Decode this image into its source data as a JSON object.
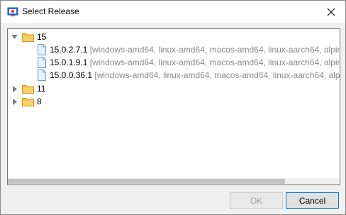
{
  "window": {
    "title": "Select Release"
  },
  "tree": {
    "nodes": [
      {
        "label": "15",
        "expanded": true
      },
      {
        "version": "15.0.2.7.1",
        "platforms": " [windows-amd64, linux-amd64, macos-amd64, linux-aarch64, alpin"
      },
      {
        "version": "15.0.1.9.1",
        "platforms": " [windows-amd64, linux-amd64, macos-amd64, linux-aarch64, alpin"
      },
      {
        "version": "15.0.0.36.1",
        "platforms": " [windows-amd64, linux-amd64, macos-amd64, linux-aarch64, alpi"
      },
      {
        "label": "11",
        "expanded": false
      },
      {
        "label": "8",
        "expanded": false
      }
    ]
  },
  "buttons": {
    "ok": "OK",
    "cancel": "Cancel"
  }
}
